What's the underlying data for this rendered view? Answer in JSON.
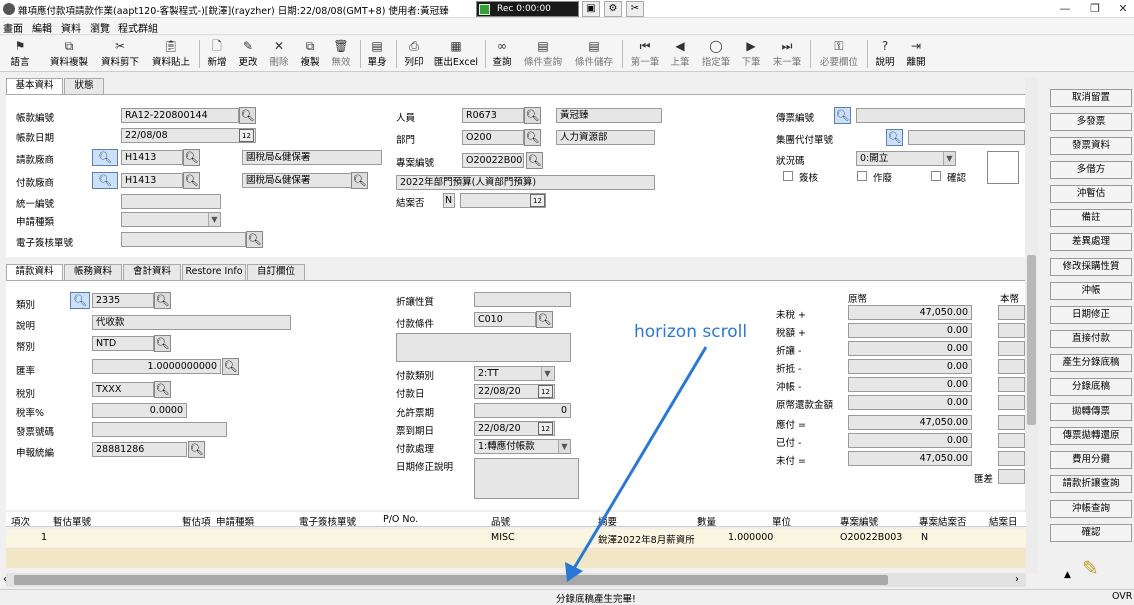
{
  "window": {
    "title": "雜項應付款項請款作業(aapt120-客製程式-)[銳澤](rayzher) 日期:22/08/08(GMT+8) 使用者:黃冠臻",
    "recorder_time": "Rec 0:00:00"
  },
  "menu": [
    "畫面",
    "編輯",
    "資料",
    "瀏覽",
    "程式群組"
  ],
  "toolbar": [
    {
      "icon": "flag-icon",
      "label": "語言"
    },
    {
      "icon": "copy-data-icon",
      "label": "資料複製"
    },
    {
      "icon": "scissors-icon",
      "label": "資料剪下"
    },
    {
      "icon": "clipboard-icon",
      "label": "資料貼上"
    },
    {
      "icon": "new-icon",
      "label": "新增"
    },
    {
      "icon": "pencil-icon",
      "label": "更改"
    },
    {
      "icon": "x-icon",
      "label": "刪除"
    },
    {
      "icon": "duplicate-icon",
      "label": "複製"
    },
    {
      "icon": "trash-icon",
      "label": "無效"
    },
    {
      "icon": "single-icon",
      "label": "單身"
    },
    {
      "icon": "printer-icon",
      "label": "列印"
    },
    {
      "icon": "excel-icon",
      "label": "匯出Excel"
    },
    {
      "icon": "binoculars-icon",
      "label": "查詢"
    },
    {
      "icon": "condition-query-icon",
      "label": "條件查詢"
    },
    {
      "icon": "condition-save-icon",
      "label": "條件儲存"
    },
    {
      "icon": "first-icon",
      "label": "第一筆"
    },
    {
      "icon": "prev-icon",
      "label": "上筆"
    },
    {
      "icon": "speech-icon",
      "label": "指定筆"
    },
    {
      "icon": "next-icon",
      "label": "下筆"
    },
    {
      "icon": "last-icon",
      "label": "末一筆"
    },
    {
      "icon": "key-icon",
      "label": "必要欄位"
    },
    {
      "icon": "help-icon",
      "label": "說明"
    },
    {
      "icon": "exit-icon",
      "label": "離開"
    }
  ],
  "top_tabs": [
    "基本資料",
    "狀態"
  ],
  "header": {
    "ap_no_label": "帳款編號",
    "ap_no": "RA12-220800144",
    "ap_date_label": "帳款日期",
    "ap_date": "22/08/08",
    "req_vendor_label": "請款廠商",
    "req_vendor": "H1413",
    "req_vendor_name": "國稅局&健保署",
    "pay_vendor_label": "付款廠商",
    "pay_vendor": "H1413",
    "pay_vendor_name": "國稅局&健保署",
    "tax_id_label": "統一編號",
    "tax_id": "",
    "req_type_label": "申請種類",
    "req_type": "",
    "esign_label": "電子簽核單號",
    "esign": "",
    "person_label": "人員",
    "person": "R0673",
    "person_name": "黃冠臻",
    "dept_label": "部門",
    "dept": "O200",
    "dept_name": "人力資源部",
    "project_label": "專案編號",
    "project": "O20022B003",
    "project_name": "2022年部門預算(人資部門預算)",
    "closed_label": "結案否",
    "closed": "N",
    "voucher_label": "傳票編號",
    "voucher": "",
    "group_pay_label": "集團代付單號",
    "group_pay": "",
    "status_label": "狀況碼",
    "status": "0:開立",
    "cb_sign": "簽核",
    "cb_void": "作廢",
    "cb_confirm": "確認"
  },
  "bottom_tabs": [
    "請款資料",
    "帳務資料",
    "會計資料",
    "Restore Info",
    "自訂欄位"
  ],
  "req": {
    "category_label": "類別",
    "category": "2335",
    "desc_label": "說明",
    "desc": "代收款",
    "currency_label": "幣別",
    "currency": "NTD",
    "rate_label": "匯率",
    "rate": "1.0000000000",
    "tax_label": "稅別",
    "tax": "TXXX",
    "tax_rate_label": "稅率%",
    "tax_rate": "0.0000",
    "invoice_label": "發票號碼",
    "invoice": "",
    "declare_label": "申報統編",
    "declare": "28881286",
    "discount_label": "折讓性質",
    "discount": "",
    "pay_terms_label": "付款條件",
    "pay_terms": "C010",
    "pay_type_label": "付款類別",
    "pay_type": "2:TT",
    "pay_date_label": "付款日",
    "pay_date": "22/08/20",
    "allow_days_label": "允許票期",
    "allow_days": "0",
    "due_date_label": "票到期日",
    "due_date": "22/08/20",
    "pay_proc_label": "付款處理",
    "pay_proc": "1:轉應付帳款",
    "date_note_label": "日期修正說明"
  },
  "amounts": {
    "orig_header": "原幣",
    "local_header": "本幣",
    "rows": [
      {
        "label": "未稅 +",
        "value": "47,050.00"
      },
      {
        "label": "稅額 +",
        "value": "0.00"
      },
      {
        "label": "折讓 -",
        "value": "0.00"
      },
      {
        "label": "折抵 -",
        "value": "0.00"
      },
      {
        "label": "沖帳 -",
        "value": "0.00"
      },
      {
        "label": "原幣還款金額",
        "value": "0.00"
      },
      {
        "label": "應付 =",
        "value": "47,050.00"
      },
      {
        "label": "已付 -",
        "value": "0.00"
      },
      {
        "label": "未付 =",
        "value": "47,050.00"
      }
    ],
    "rate_diff_label": "匯差"
  },
  "right_buttons": [
    "取消留置",
    "多發票",
    "發票資料",
    "多借方",
    "沖暫估",
    "備註",
    "差異處理",
    "修改採購性質",
    "沖帳",
    "日期修正",
    "直接付款",
    "產生分錄底稿",
    "分錄底稿",
    "拋轉傳票",
    "傳票拋轉還原",
    "費用分攤",
    "請款折讓查詢",
    "沖帳查詢",
    "確認"
  ],
  "grid": {
    "headers": [
      "項次",
      "暫估單號",
      "暫估項",
      "申請種類",
      "電子簽核單號",
      "P/O No.",
      "品號",
      "摘要",
      "數量",
      "單位",
      "專案編號",
      "專案結案否",
      "結案日"
    ],
    "rows": [
      {
        "no": "1",
        "item": "MISC",
        "summary": "銳澤2022年8月薪資所",
        "qty": "1.000000",
        "project": "O20022B003",
        "closed": "N"
      }
    ]
  },
  "status": {
    "message": "分錄底稿產生完畢!",
    "mode": "OVR"
  },
  "annotation": "horizon scroll"
}
